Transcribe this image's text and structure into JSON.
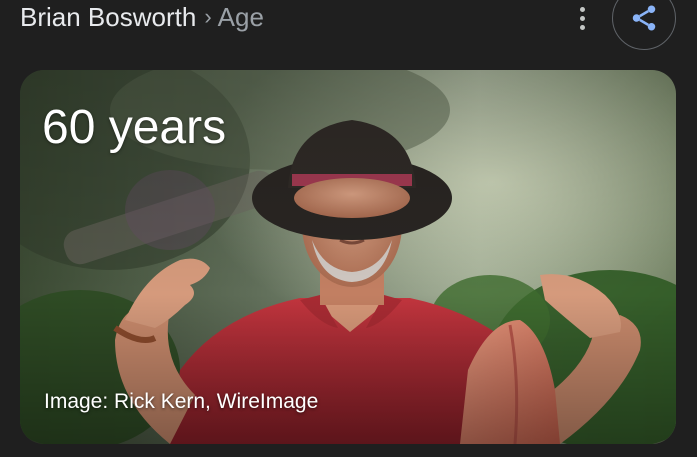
{
  "header": {
    "entity": "Brian Bosworth",
    "separator": "›",
    "attribute": "Age"
  },
  "card": {
    "age_value": "60 years",
    "image_credit": "Image: Rick Kern, WireImage"
  },
  "icons": {
    "more": "more-vert-icon",
    "share": "share-icon"
  },
  "colors": {
    "background": "#1f1f1f",
    "share_accent": "#8ab4f8",
    "shirt": "#b32d36",
    "hat": "#2a2623"
  }
}
